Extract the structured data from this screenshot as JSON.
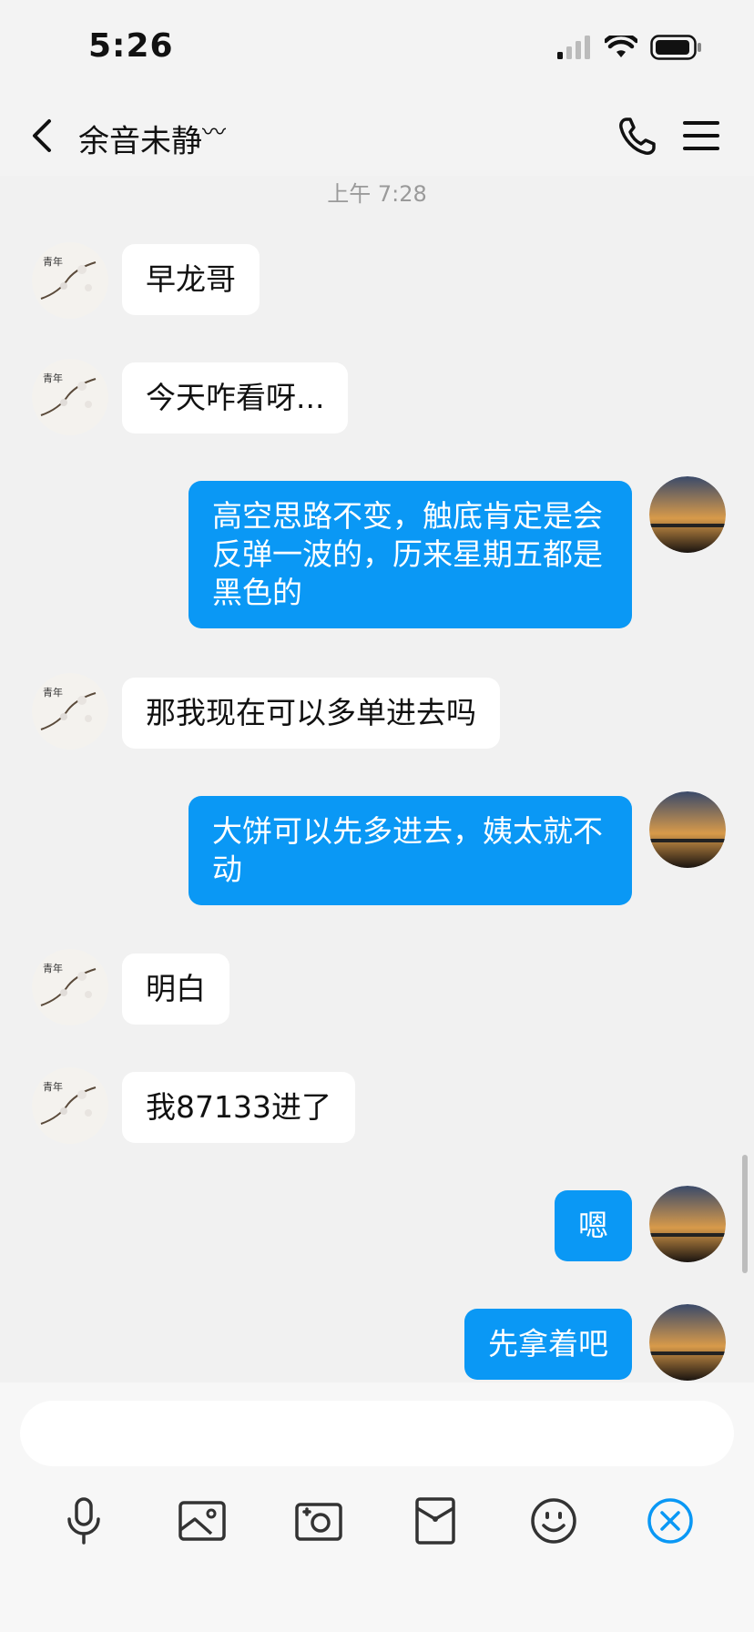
{
  "status_bar": {
    "time": "5:26"
  },
  "header": {
    "title": "余音未静",
    "title_suffix": "〰"
  },
  "chat": {
    "timestamp": "上午 7:28",
    "messages": [
      {
        "from": "them",
        "text": "早龙哥"
      },
      {
        "from": "them",
        "text": "今天咋看呀..."
      },
      {
        "from": "me",
        "text": "高空思路不变，触底肯定是会反弹一波的，历来星期五都是黑色的"
      },
      {
        "from": "them",
        "text": "那我现在可以多单进去吗"
      },
      {
        "from": "me",
        "text": "大饼可以先多进去，姨太就不动"
      },
      {
        "from": "them",
        "text": "明白"
      },
      {
        "from": "them",
        "text": "我87133进了"
      },
      {
        "from": "me",
        "text": "嗯"
      },
      {
        "from": "me",
        "text": "先拿着吧"
      }
    ]
  },
  "colors": {
    "accent": "#0a98f5",
    "their_bubble": "#ffffff",
    "background": "#f1f1f1"
  },
  "toolbar": {
    "icons": [
      "microphone-icon",
      "image-icon",
      "camera-icon",
      "red-packet-icon",
      "emoji-icon",
      "close-circle-icon"
    ]
  }
}
